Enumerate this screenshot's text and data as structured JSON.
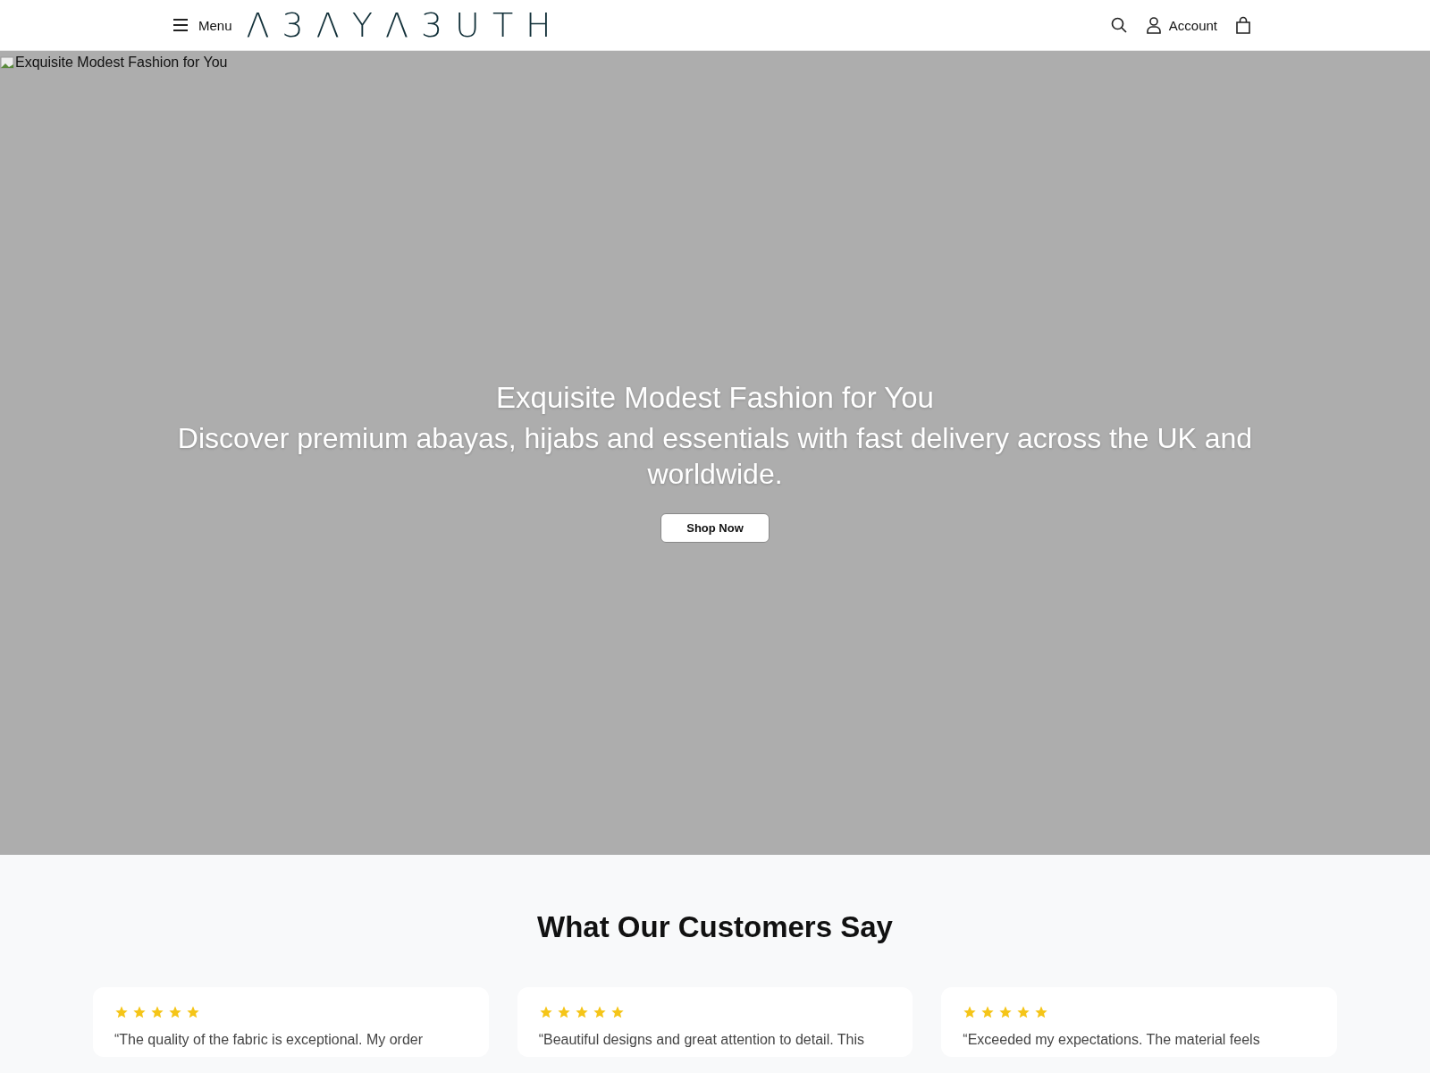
{
  "header": {
    "menu_label": "Menu",
    "logo": "Λ3ΛYΛ3UTH",
    "account_label": "Account"
  },
  "hero": {
    "image_alt": "Exquisite Modest Fashion for You",
    "title": "Exquisite Modest Fashion for You",
    "subtitle": "Discover premium abayas, hijabs and essentials with fast delivery across the UK and worldwide.",
    "button": "Shop Now"
  },
  "testimonials": {
    "heading": "What Our Customers Say",
    "items": [
      {
        "stars": 5,
        "quote": "“The quality of the fabric is exceptional. My order"
      },
      {
        "stars": 5,
        "quote": "“Beautiful designs and great attention to detail. This"
      },
      {
        "stars": 5,
        "quote": "“Exceeded my expectations. The material feels"
      }
    ]
  }
}
